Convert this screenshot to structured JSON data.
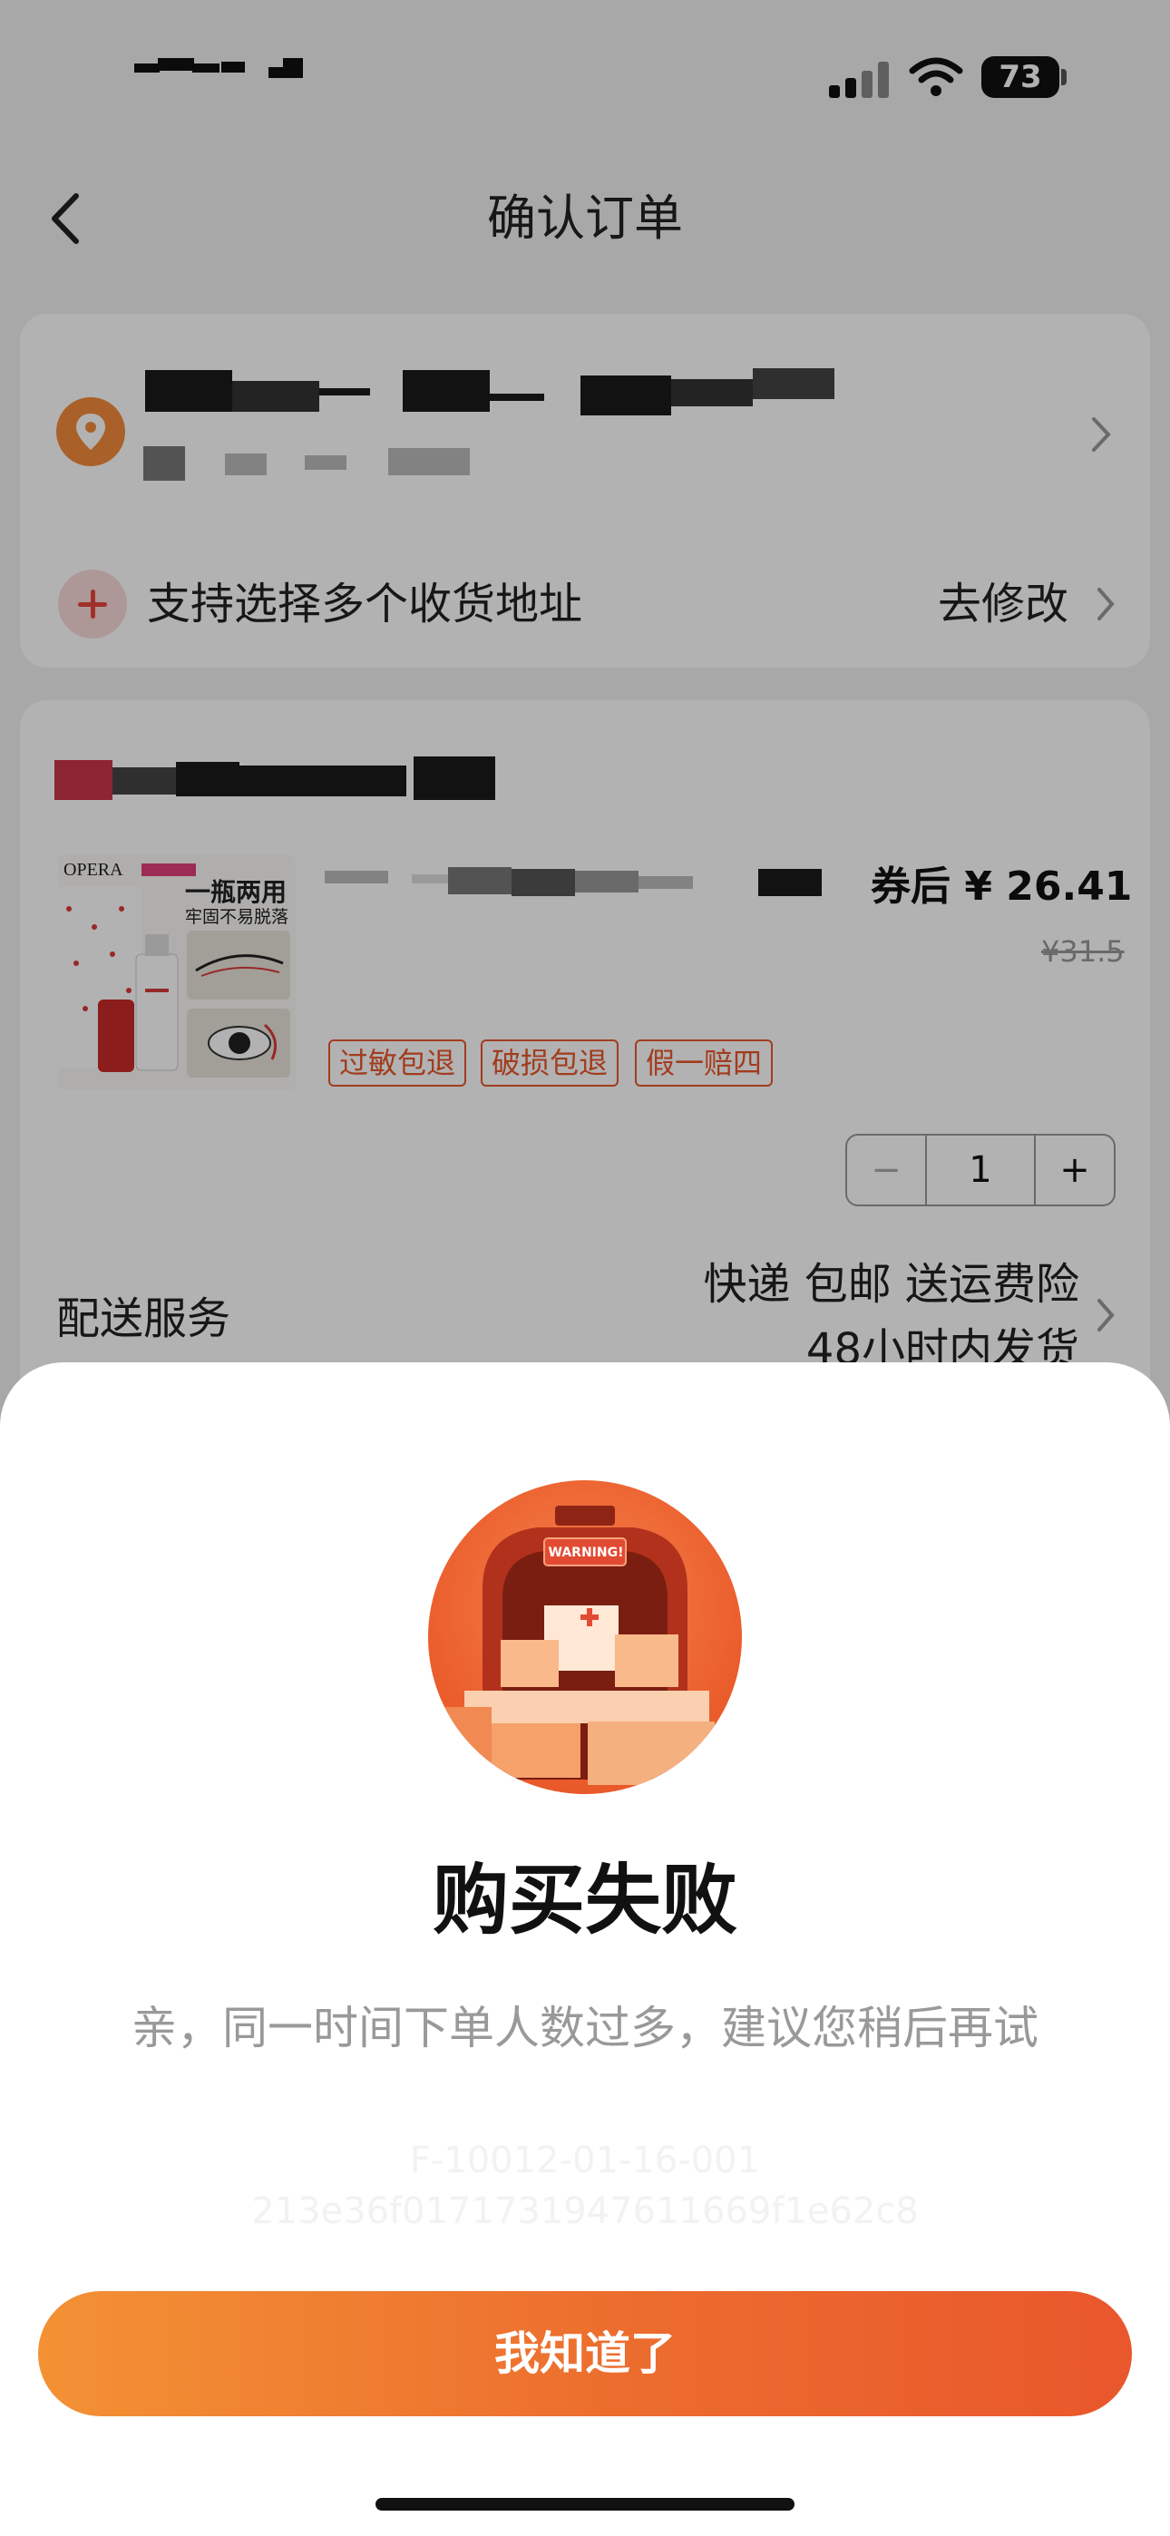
{
  "status_bar": {
    "battery": "73"
  },
  "nav": {
    "title": "确认订单"
  },
  "address": {
    "multi_address_label": "支持选择多个收货地址",
    "modify_label": "去修改"
  },
  "product": {
    "image_text": {
      "brand": "OPERA",
      "headline": "一瓶两用",
      "subline": "牢固不易脱落"
    },
    "price_label": "券后 ¥ 26.41",
    "original_price": "¥31.5",
    "tags": [
      "过敏包退",
      "破损包退",
      "假一赔四"
    ],
    "quantity": "1",
    "minus": "−",
    "plus": "+"
  },
  "delivery": {
    "label": "配送服务",
    "value": "快递 包邮 送运费险",
    "value2": "48小时内发货"
  },
  "dialog": {
    "illustration_text": "WARNING!",
    "title": "购买失败",
    "message": "亲，同一时间下单人数过多，建议您稍后再试",
    "error_code_1": "F-10012-01-16-001",
    "error_code_2": "213e36f0171731947611669f1e62c8",
    "button_label": "我知道了"
  },
  "colors": {
    "accent": "#e9572c",
    "accent_start": "#f39134"
  }
}
